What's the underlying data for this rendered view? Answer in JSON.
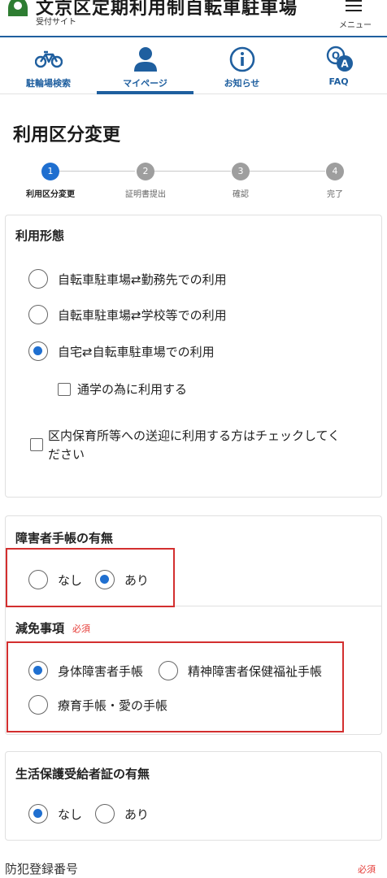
{
  "header": {
    "title": "文京区定期利用制自転車駐車場",
    "subtitle": "受付サイト",
    "menu_label": "メニュー"
  },
  "nav": {
    "tabs": [
      {
        "label": "駐輪場検索",
        "icon": "bicycle-icon",
        "active": false
      },
      {
        "label": "マイページ",
        "icon": "user-icon",
        "active": true
      },
      {
        "label": "お知らせ",
        "icon": "info-icon",
        "active": false
      },
      {
        "label": "FAQ",
        "icon": "faq-icon",
        "active": false
      }
    ]
  },
  "page_title": "利用区分変更",
  "stepper": {
    "steps": [
      {
        "number": "1",
        "label": "利用区分変更",
        "active": true
      },
      {
        "number": "2",
        "label": "証明書提出",
        "active": false
      },
      {
        "number": "3",
        "label": "確認",
        "active": false
      },
      {
        "number": "4",
        "label": "完了",
        "active": false
      }
    ]
  },
  "usage_type": {
    "title": "利用形態",
    "options": [
      {
        "label": "自転車駐車場⇄勤務先での利用",
        "checked": false
      },
      {
        "label": "自転車駐車場⇄学校等での利用",
        "checked": false
      },
      {
        "label": "自宅⇄自転車駐車場での利用",
        "checked": true
      }
    ],
    "school_checkbox": "通学の為に利用する",
    "nursery_checkbox_line1": "区内保育所等への送迎に利用する方はチェックしてく",
    "nursery_checkbox_line2": "ださい"
  },
  "disability": {
    "title": "障害者手帳の有無",
    "options": [
      {
        "label": "なし",
        "checked": false
      },
      {
        "label": "あり",
        "checked": true
      }
    ],
    "exemption_title": "減免事項",
    "required_label": "必須",
    "exemption_options": [
      {
        "label": "身体障害者手帳",
        "checked": true
      },
      {
        "label": "精神障害者保健福祉手帳",
        "checked": false
      },
      {
        "label": "療育手帳・愛の手帳",
        "checked": false
      }
    ]
  },
  "welfare": {
    "title": "生活保護受給者証の有無",
    "options": [
      {
        "label": "なし",
        "checked": true
      },
      {
        "label": "あり",
        "checked": false
      }
    ]
  },
  "crime_prevention": {
    "title": "防犯登録番号",
    "required_label": "必須"
  },
  "colors": {
    "brand": "#1f5f9f",
    "accent": "#1f6fd0",
    "required": "#e53935",
    "highlight": "#d32f2f"
  }
}
